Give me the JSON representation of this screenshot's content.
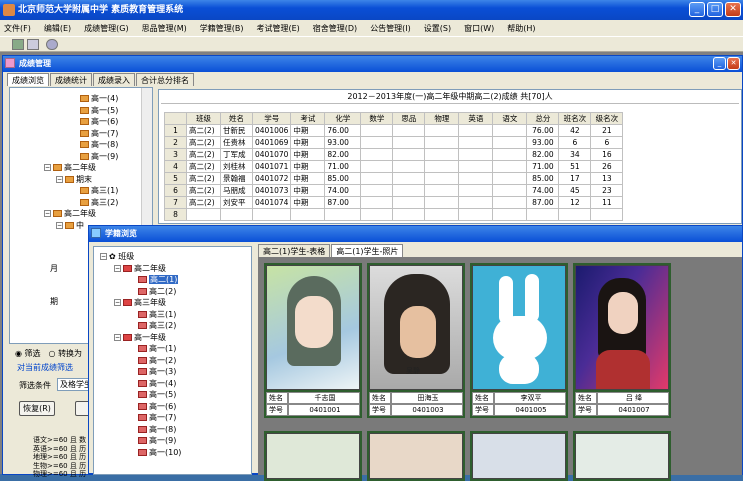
{
  "app": {
    "title": "北京师范大学附属中学 素质教育管理系统"
  },
  "menu": [
    "文件(F)",
    "编辑(E)",
    "成绩管理(G)",
    "思品管理(M)",
    "学籍管理(B)",
    "考试管理(E)",
    "宿舍管理(D)",
    "公告管理(I)",
    "设置(S)",
    "窗口(W)",
    "帮助(H)"
  ],
  "score_window": {
    "title": "成绩管理",
    "tabs": [
      "成绩浏览",
      "成绩统计",
      "成绩录入",
      "合计总分排名"
    ],
    "table_title": "2012－2013年度(一)高二年级中期高二(2)成绩  共[70]人",
    "columns": [
      "班级",
      "姓名",
      "学号",
      "考试",
      "化学",
      "数学",
      "思品",
      "物理",
      "英语",
      "语文",
      "总分",
      "班名次",
      "级名次"
    ],
    "rows": [
      {
        "n": "1",
        "cells": [
          "高二(2)",
          "甘新民",
          "0401006",
          "中期",
          "76.00",
          "",
          "",
          "",
          "",
          "",
          "76.00",
          "42",
          "21"
        ]
      },
      {
        "n": "2",
        "cells": [
          "高二(2)",
          "任贵林",
          "0401069",
          "中期",
          "93.00",
          "",
          "",
          "",
          "",
          "",
          "93.00",
          "6",
          "6"
        ]
      },
      {
        "n": "3",
        "cells": [
          "高二(2)",
          "丁军成",
          "0401070",
          "中期",
          "82.00",
          "",
          "",
          "",
          "",
          "",
          "82.00",
          "34",
          "16"
        ]
      },
      {
        "n": "4",
        "cells": [
          "高二(2)",
          "刘桂林",
          "0401071",
          "中期",
          "71.00",
          "",
          "",
          "",
          "",
          "",
          "71.00",
          "51",
          "26"
        ]
      },
      {
        "n": "5",
        "cells": [
          "高二(2)",
          "景翰福",
          "0401072",
          "中期",
          "85.00",
          "",
          "",
          "",
          "",
          "",
          "85.00",
          "17",
          "13"
        ]
      },
      {
        "n": "6",
        "cells": [
          "高二(2)",
          "马朋成",
          "0401073",
          "中期",
          "74.00",
          "",
          "",
          "",
          "",
          "",
          "74.00",
          "45",
          "23"
        ]
      },
      {
        "n": "7",
        "cells": [
          "高二(2)",
          "刘安平",
          "0401074",
          "中期",
          "87.00",
          "",
          "",
          "",
          "",
          "",
          "87.00",
          "12",
          "11"
        ]
      },
      {
        "n": "8",
        "cells": [
          "",
          "",
          "",
          "",
          "",
          "",
          "",
          "",
          "",
          "",
          "",
          "",
          ""
        ]
      }
    ],
    "tree": [
      {
        "label": "高一(4)",
        "level": 3
      },
      {
        "label": "高一(5)",
        "level": 3
      },
      {
        "label": "高一(6)",
        "level": 3
      },
      {
        "label": "高一(7)",
        "level": 3
      },
      {
        "label": "高一(8)",
        "level": 3
      },
      {
        "label": "高一(9)",
        "level": 3
      },
      {
        "label": "高二年级",
        "level": 1
      },
      {
        "label": "期末",
        "level": 2
      },
      {
        "label": "高三(1)",
        "level": 3
      },
      {
        "label": "高三(2)",
        "level": 3
      },
      {
        "label": "高二年级",
        "level": 1
      },
      {
        "label": "中",
        "level": 2
      }
    ],
    "partial": {
      "month": "月",
      "period": "期"
    },
    "filter": {
      "radio1": "筛选",
      "radio2": "转换为",
      "link": "对当前成绩筛选",
      "cond_label": "筛选条件",
      "cond_value": "及格学生",
      "reset_btn": "恢复(R)"
    },
    "notes": [
      "语文>=60 且 数",
      "英语>=60 且 历",
      "地理>=60 且 历",
      "生物>=60 且 历",
      "物理>=60 且 历"
    ]
  },
  "student_window": {
    "title": "学籍浏览",
    "tabs": [
      "高二(1)学生-表格",
      "高二(1)学生-照片"
    ],
    "tree": [
      {
        "label": "班级",
        "level": 0
      },
      {
        "label": "高二年级",
        "level": 1
      },
      {
        "label": "高二(1)",
        "level": 2,
        "selected": true
      },
      {
        "label": "高二(2)",
        "level": 2
      },
      {
        "label": "高三年级",
        "level": 1
      },
      {
        "label": "高三(1)",
        "level": 2
      },
      {
        "label": "高三(2)",
        "level": 2
      },
      {
        "label": "高一年级",
        "level": 1
      },
      {
        "label": "高一(1)",
        "level": 2
      },
      {
        "label": "高一(2)",
        "level": 2
      },
      {
        "label": "高一(3)",
        "level": 2
      },
      {
        "label": "高一(4)",
        "level": 2
      },
      {
        "label": "高一(5)",
        "level": 2
      },
      {
        "label": "高一(6)",
        "level": 2
      },
      {
        "label": "高一(7)",
        "level": 2
      },
      {
        "label": "高一(8)",
        "level": 2
      },
      {
        "label": "高一(9)",
        "level": 2
      },
      {
        "label": "高一(10)",
        "level": 2
      }
    ],
    "name_label": "姓名",
    "id_label": "学号",
    "students": [
      {
        "name": "千志国",
        "id": "0401001"
      },
      {
        "name": "田海玉",
        "id": "0401003"
      },
      {
        "name": "李双平",
        "id": "0401005"
      },
      {
        "name": "吕 绛",
        "id": "0401007"
      }
    ],
    "photo_caption": "吴静"
  },
  "colors": {
    "title": "#0a4fd6",
    "card_border": "#2e5e2e",
    "face": "#ece9d8"
  }
}
